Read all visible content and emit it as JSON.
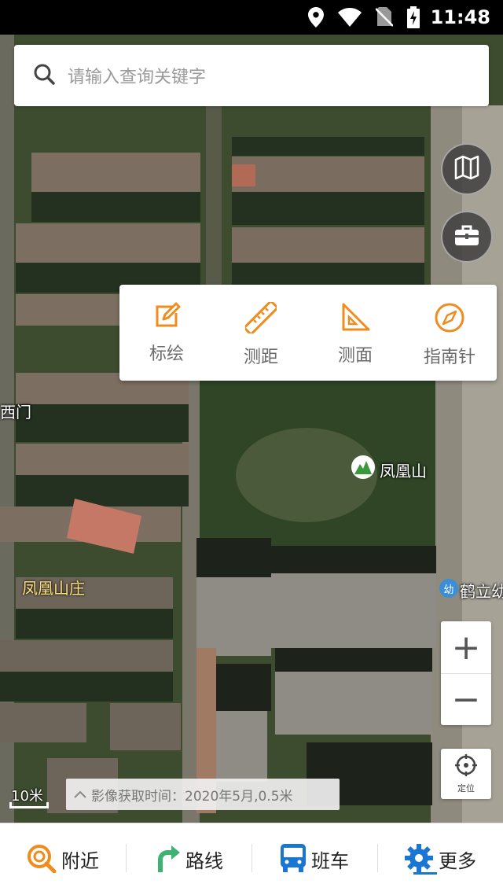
{
  "status_bar": {
    "time": "11:48",
    "icons": [
      "location-icon",
      "wifi-icon",
      "no-sim-icon",
      "battery-charging-icon"
    ]
  },
  "search": {
    "placeholder": "请输入查询关键字",
    "icon": "search-icon"
  },
  "right_controls": {
    "layers_icon": "map-icon",
    "toolbox_icon": "toolbox-icon"
  },
  "tools_popup": {
    "items": [
      {
        "label": "标绘",
        "icon": "edit-icon"
      },
      {
        "label": "测距",
        "icon": "ruler-icon"
      },
      {
        "label": "测面",
        "icon": "triangle-ruler-icon"
      },
      {
        "label": "指南针",
        "icon": "compass-icon"
      }
    ],
    "accent": "#f08c1e"
  },
  "map": {
    "labels": {
      "phoenix_mountain": "凤凰山",
      "phoenix_village": "凤凰山庄",
      "west_gate": "西门",
      "kindergarten": "鹤立幼",
      "kindergarten_badge": "幼"
    }
  },
  "zoom": {
    "in_label": "+",
    "out_label": "−"
  },
  "locate": {
    "label": "定位"
  },
  "scale": {
    "text": "10米"
  },
  "capture_info": {
    "text": "影像获取时间：2020年5月,0.5米"
  },
  "bottom_nav": {
    "items": [
      {
        "label": "附近",
        "icon": "nearby-search-icon"
      },
      {
        "label": "路线",
        "icon": "route-arrow-icon"
      },
      {
        "label": "班车",
        "icon": "bus-icon"
      },
      {
        "label": "更多",
        "icon": "gear-icon"
      }
    ],
    "colors": {
      "orange": "#f08c1e",
      "green": "#3cb371",
      "blue": "#1976d2"
    }
  }
}
